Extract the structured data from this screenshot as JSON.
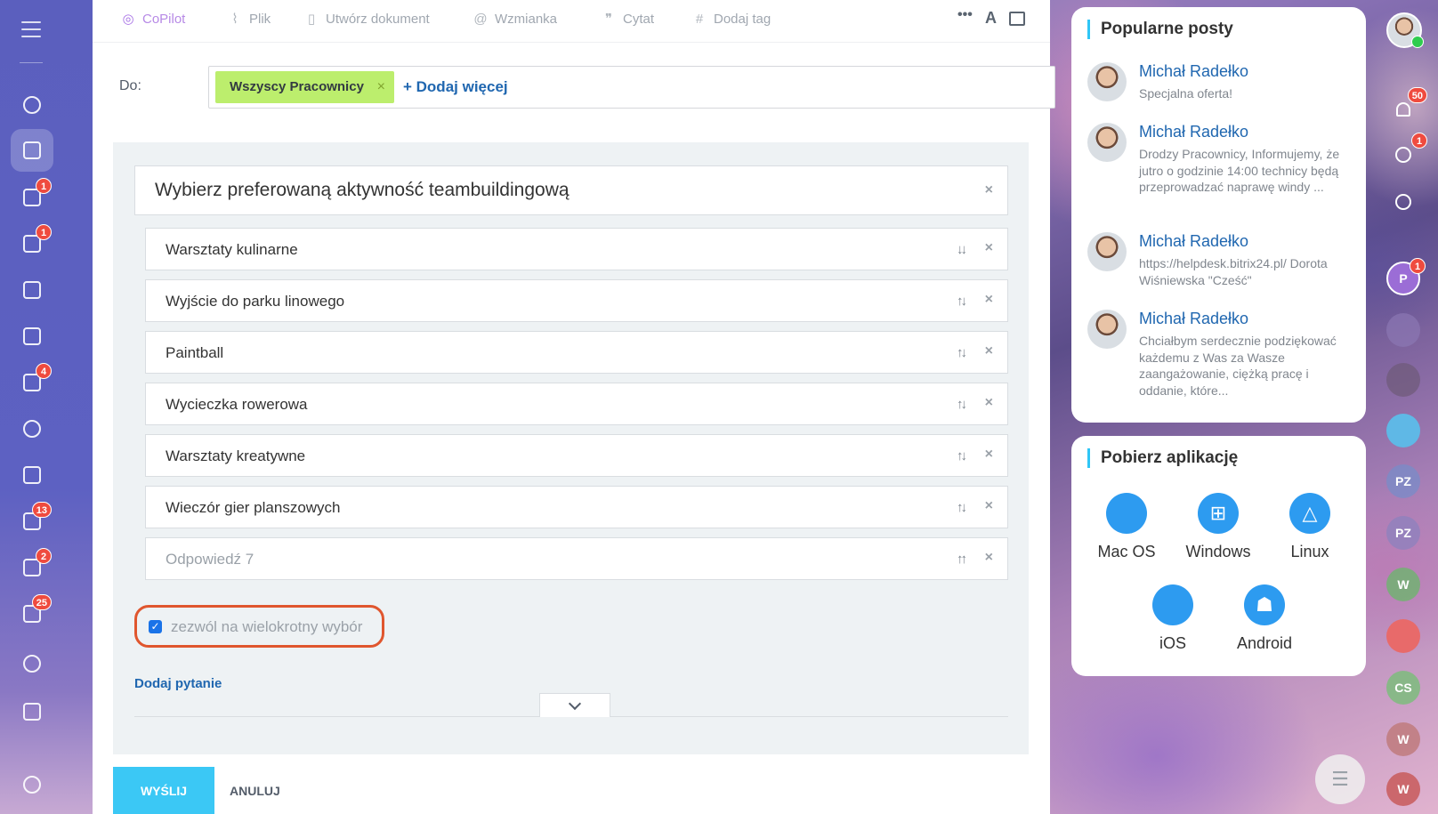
{
  "toolbar": {
    "items": [
      {
        "label": "CoPilot",
        "icon": "copilot-icon"
      },
      {
        "label": "Plik",
        "icon": "paperclip-icon"
      },
      {
        "label": "Utwórz dokument",
        "icon": "document-icon"
      },
      {
        "label": "Wzmianka",
        "icon": "at-icon"
      },
      {
        "label": "Cytat",
        "icon": "quote-icon"
      },
      {
        "label": "Dodaj tag",
        "icon": "hash-icon"
      }
    ],
    "more_glyph": "•••",
    "font_glyph": "A"
  },
  "recipients": {
    "label": "Do:",
    "chip": "Wszyscy Pracownicy",
    "chip_remove": "×",
    "add_more": "+ Dodaj więcej"
  },
  "poll": {
    "question": "Wybierz preferowaną aktywność teambuildingową",
    "answers": [
      {
        "text": "Warsztaty kulinarne",
        "sort": "↓↓"
      },
      {
        "text": "Wyjście do parku linowego",
        "sort": "↑↓"
      },
      {
        "text": "Paintball",
        "sort": "↑↓"
      },
      {
        "text": "Wycieczka rowerowa",
        "sort": "↑↓"
      },
      {
        "text": "Warsztaty kreatywne",
        "sort": "↑↓"
      },
      {
        "text": "Wieczór gier planszowych",
        "sort": "↑↓"
      }
    ],
    "placeholder_answer": {
      "text": "Odpowiedź 7",
      "sort": "↑↑"
    },
    "remove_glyph": "×",
    "multiple_choice": {
      "label": "zezwól na wielokrotny wybór",
      "checked": true,
      "check_glyph": "✓"
    },
    "add_question": "Dodaj pytanie"
  },
  "actions": {
    "send": "WYŚLIJ",
    "cancel": "ANULUJ"
  },
  "popular_posts": {
    "title": "Popularne posty",
    "posts": [
      {
        "author": "Michał Radełko",
        "excerpt": "Specjalna oferta!"
      },
      {
        "author": "Michał Radełko",
        "excerpt": "Drodzy Pracownicy, Informujemy, że jutro o godzinie 14:00 technicy będą przeprowadzać naprawę windy ..."
      },
      {
        "author": "Michał Radełko",
        "excerpt": "https://helpdesk.bitrix24.pl/ Dorota Wiśniewska \"Cześć\""
      },
      {
        "author": "Michał Radełko",
        "excerpt": "Chciałbym serdecznie podziękować każdemu z Was za Wasze zaangażowanie, ciężką pracę i oddanie, które..."
      }
    ]
  },
  "apps": {
    "title": "Pobierz aplikację",
    "items": [
      {
        "name": "Mac OS",
        "glyph": ""
      },
      {
        "name": "Windows",
        "glyph": "⊞"
      },
      {
        "name": "Linux",
        "glyph": "△"
      },
      {
        "name": "iOS",
        "glyph": ""
      },
      {
        "name": "Android",
        "glyph": "☗"
      }
    ]
  },
  "sidebar_badges": [
    "1",
    "1",
    "4",
    "13",
    "2",
    "25"
  ],
  "right_column": {
    "notifications_badge": "50",
    "copilot_badge": "1",
    "avatar_p": {
      "letter": "P",
      "badge": "1"
    },
    "initials": [
      "PZ",
      "PZ",
      "W",
      "CS",
      "W",
      "W"
    ]
  },
  "colors": {
    "sidebar": "#5b5fbe",
    "accent_blue": "#2067b0",
    "send_button": "#3bc8f5",
    "chip": "#bcee6d",
    "highlight": "#e0562e",
    "badge": "#ef4b3f"
  }
}
